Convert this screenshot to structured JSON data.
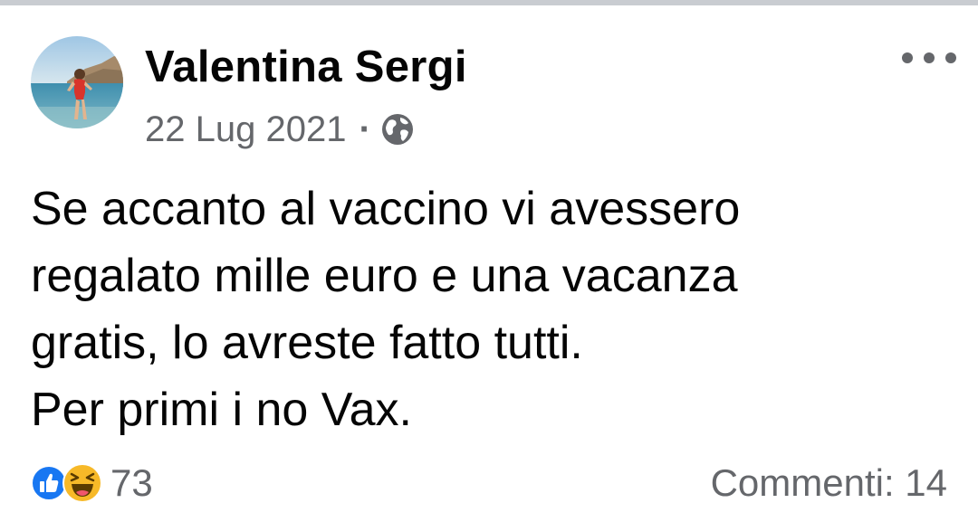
{
  "post": {
    "author": "Valentina Sergi",
    "date": "22 Lug 2021",
    "separator": "·",
    "privacy_icon": "globe-icon",
    "menu_icon": "more-options-icon",
    "text_lines": [
      "Se accanto al vaccino vi avessero",
      "regalato mille euro e una vacanza",
      "gratis, lo avreste fatto tutti.",
      "Per primi i no Vax."
    ],
    "reaction_icons": [
      "like-icon",
      "haha-icon"
    ],
    "reaction_count": "73",
    "comments_label": "Commenti: 14"
  },
  "colors": {
    "text": "#050505",
    "secondary_text": "#65676b",
    "like_blue": "#1877f2",
    "haha_yellow": "#f7b928",
    "divider": "#c9ccd1"
  }
}
